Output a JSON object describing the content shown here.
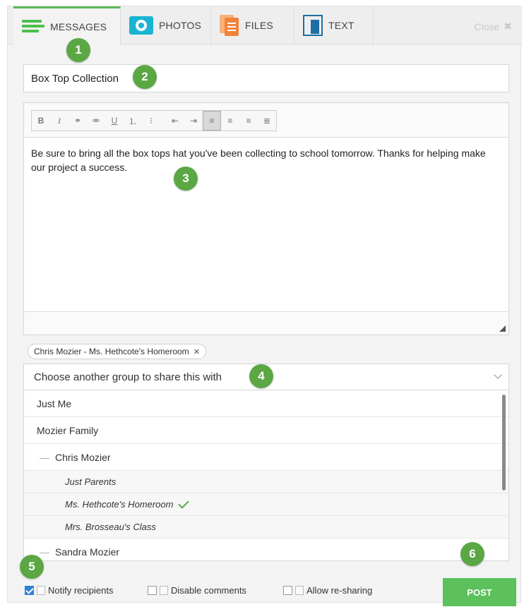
{
  "colors": {
    "accent": "#5cb85c",
    "badge": "#5aa744",
    "post_button": "#5cc05c"
  },
  "tabs": [
    {
      "label": "MESSAGES",
      "icon": "messages-lines-icon",
      "active": true
    },
    {
      "label": "PHOTOS",
      "icon": "camera-icon",
      "active": false
    },
    {
      "label": "FILES",
      "icon": "files-icon",
      "active": false
    },
    {
      "label": "TEXT",
      "icon": "text-doc-icon",
      "active": false
    }
  ],
  "close_label": "Close",
  "close_glyph": "✖",
  "badges": [
    "1",
    "2",
    "3",
    "4",
    "5",
    "6"
  ],
  "subject": {
    "value": "Box Top Collection"
  },
  "toolbar": {
    "bold": "B",
    "italic": "I",
    "link": "⚭",
    "unlink": "⚮",
    "underline": "U",
    "ordered_list": "⒈",
    "unordered_list": "⁝",
    "outdent": "⇤",
    "indent": "⇥",
    "align_left": "≡",
    "align_center": "≡",
    "align_right": "≡",
    "justify": "≣"
  },
  "message": {
    "body": "Be sure to bring all the box tops hat you've been collecting to school tomorrow. Thanks for helping make our project a success."
  },
  "recipient_chip": {
    "label": "Chris Mozier - Ms. Hethcote's Homeroom",
    "remove": "✕"
  },
  "group_select": {
    "placeholder": "Choose another group to share this with",
    "options": [
      {
        "label": "Just Me",
        "level": 0
      },
      {
        "label": "Mozier Family",
        "level": 0
      },
      {
        "label": "Chris Mozier",
        "level": 1,
        "dash": "—"
      },
      {
        "label": "Just Parents",
        "level": 2
      },
      {
        "label": "Ms. Hethcote's Homeroom",
        "level": 2,
        "selected": true
      },
      {
        "label": "Mrs. Brosseau's Class",
        "level": 2
      },
      {
        "label": "Sandra Mozier",
        "level": 1,
        "dash": "—"
      }
    ]
  },
  "footer": {
    "notify_label": "Notify recipients",
    "notify_checked": true,
    "disable_comments_label": "Disable comments",
    "disable_comments_checked": false,
    "allow_resharing_label": "Allow re-sharing",
    "allow_resharing_checked": false,
    "post_label": "POST"
  }
}
